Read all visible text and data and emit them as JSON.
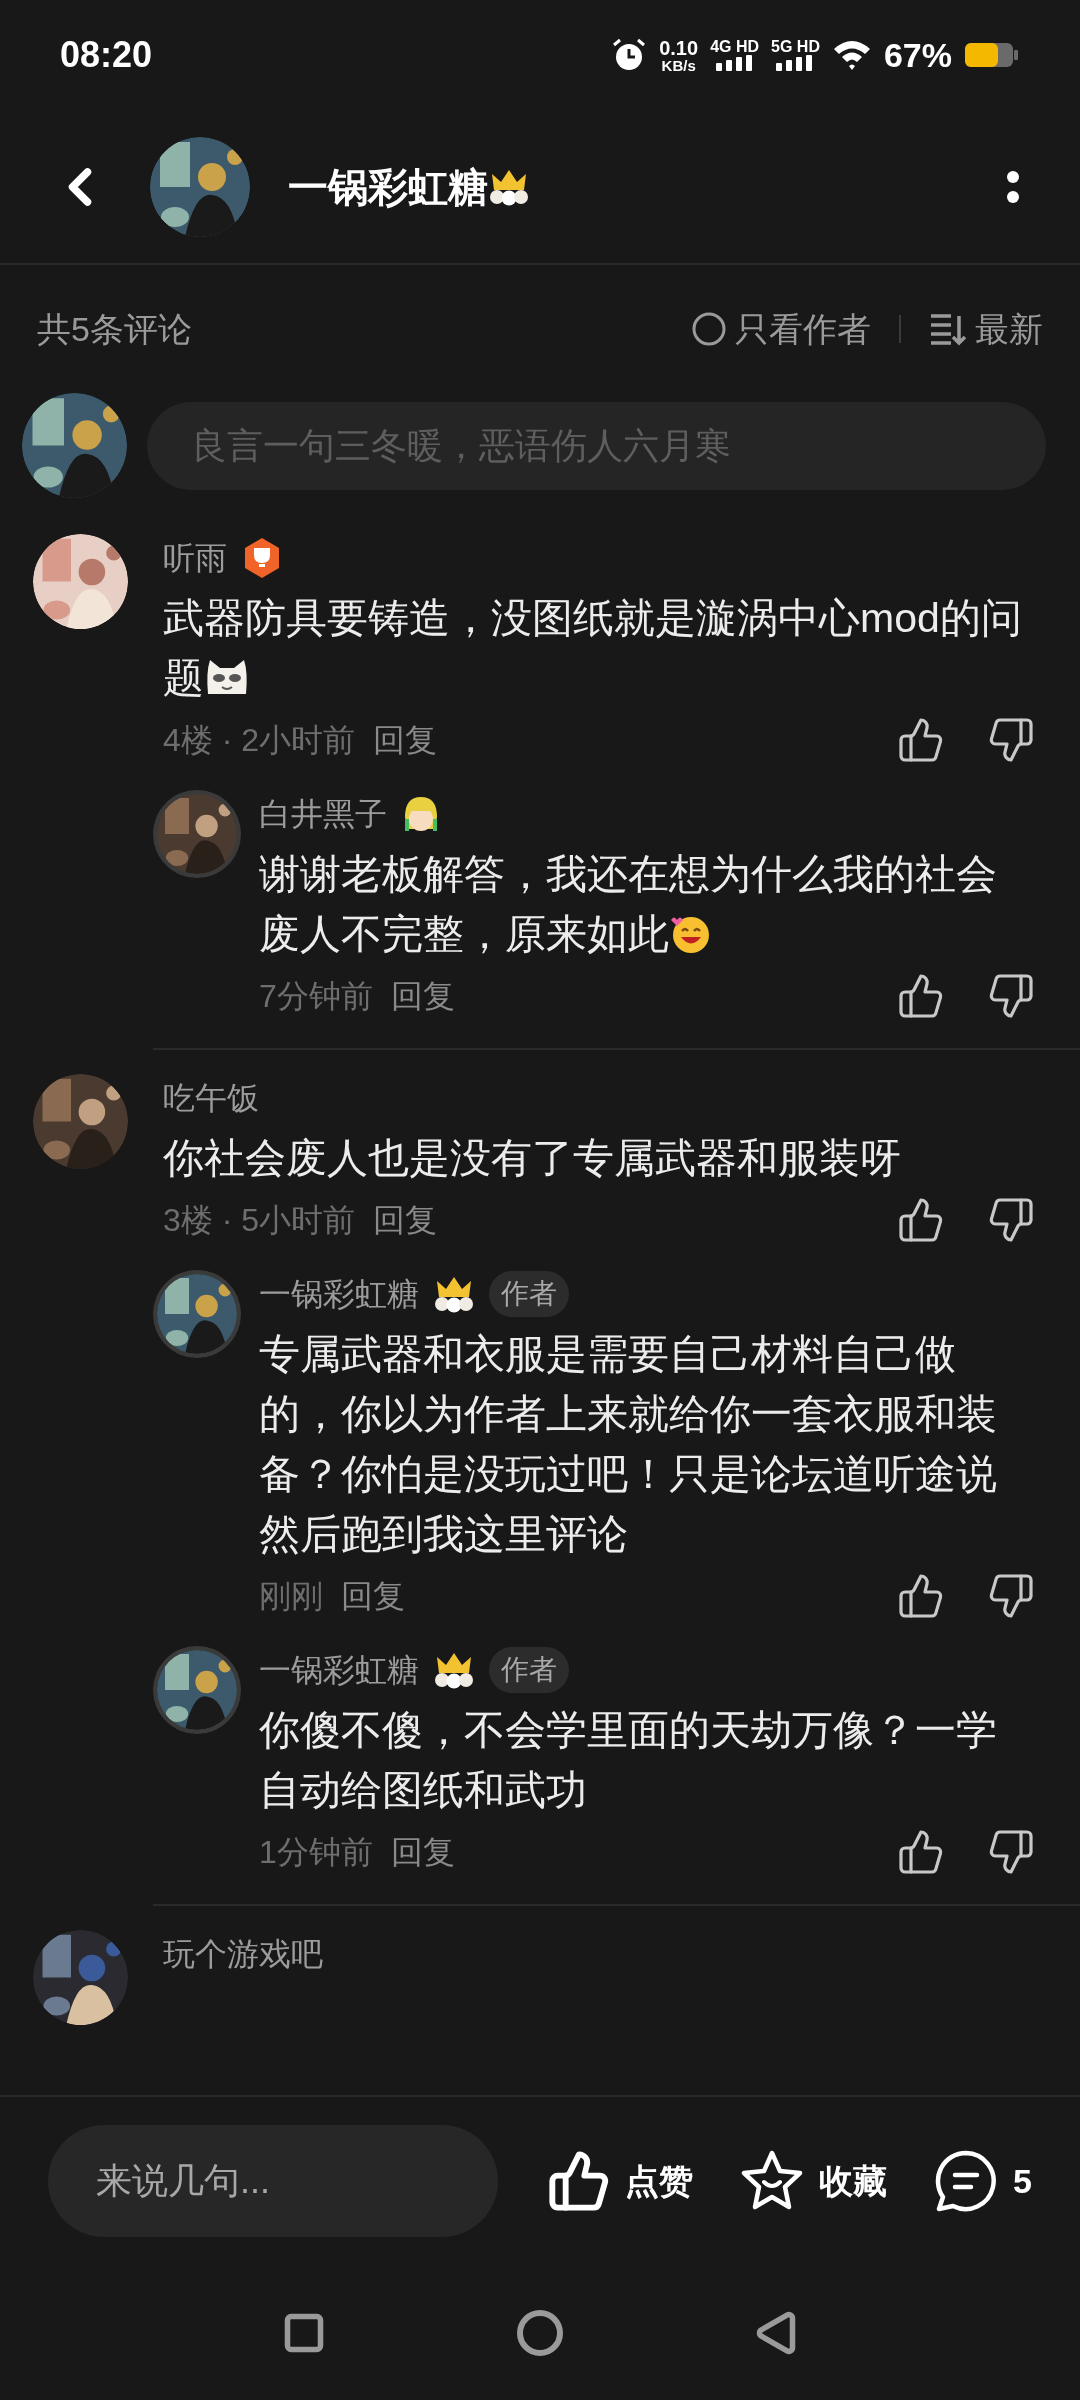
{
  "status_bar": {
    "time": "08:20",
    "speed": "0.10",
    "speed_unit": "KB/s",
    "networks": [
      "4G HD",
      "5G HD"
    ],
    "battery": "67%"
  },
  "header": {
    "title": "一锅彩虹糖",
    "badge": {
      "kind": "crown"
    }
  },
  "toolbar": {
    "count": "共5条评论",
    "filters": [
      {
        "kind": "radio",
        "label": "只看作者",
        "selected": false
      },
      {
        "kind": "sort",
        "label": "最新"
      }
    ]
  },
  "comment_field": {
    "placeholder": "良言一句三冬暖，恶语伤人六月寒"
  },
  "comments": [
    {
      "name": "听雨",
      "badge": {
        "kind": "trophy"
      },
      "text": "武器防具要铸造，没图纸就是漩涡中心mod的问题",
      "sticker": {
        "kind": "cat"
      },
      "meta": "4楼 · 2小时前",
      "reply": "回复",
      "replies": [
        {
          "name": "白井黑子",
          "badge": {
            "kind": "face"
          },
          "text": "谢谢老板解答，我还在想为什么我的社会废人不完整，原来如此",
          "sticker": {
            "kind": "grin"
          },
          "meta": "7分钟前",
          "reply": "回复"
        }
      ]
    },
    {
      "name": "吃午饭",
      "text": "你社会废人也是没有了专属武器和服装呀",
      "meta": "3楼 · 5小时前",
      "reply": "回复",
      "replies": [
        {
          "name": "一锅彩虹糖",
          "badge": {
            "kind": "crown"
          },
          "tag": "作者",
          "text": "专属武器和衣服是需要自己材料自己做的，你以为作者上来就给你一套衣服和装备？你怕是没玩过吧！只是论坛道听途说然后跑到我这里评论",
          "meta": "刚刚",
          "reply": "回复"
        },
        {
          "name": "一锅彩虹糖",
          "badge": {
            "kind": "crown"
          },
          "tag": "作者",
          "text": "你傻不傻，不会学里面的天劫万像？一学自动给图纸和武功",
          "meta": "1分钟前",
          "reply": "回复"
        }
      ]
    },
    {
      "name": "玩个游戏吧"
    }
  ],
  "bottom_bar": {
    "placeholder": "来说几句...",
    "actions": [
      {
        "kind": "like",
        "label": "点赞"
      },
      {
        "kind": "favorite",
        "label": "收藏"
      },
      {
        "kind": "comments",
        "label": "5"
      }
    ]
  }
}
